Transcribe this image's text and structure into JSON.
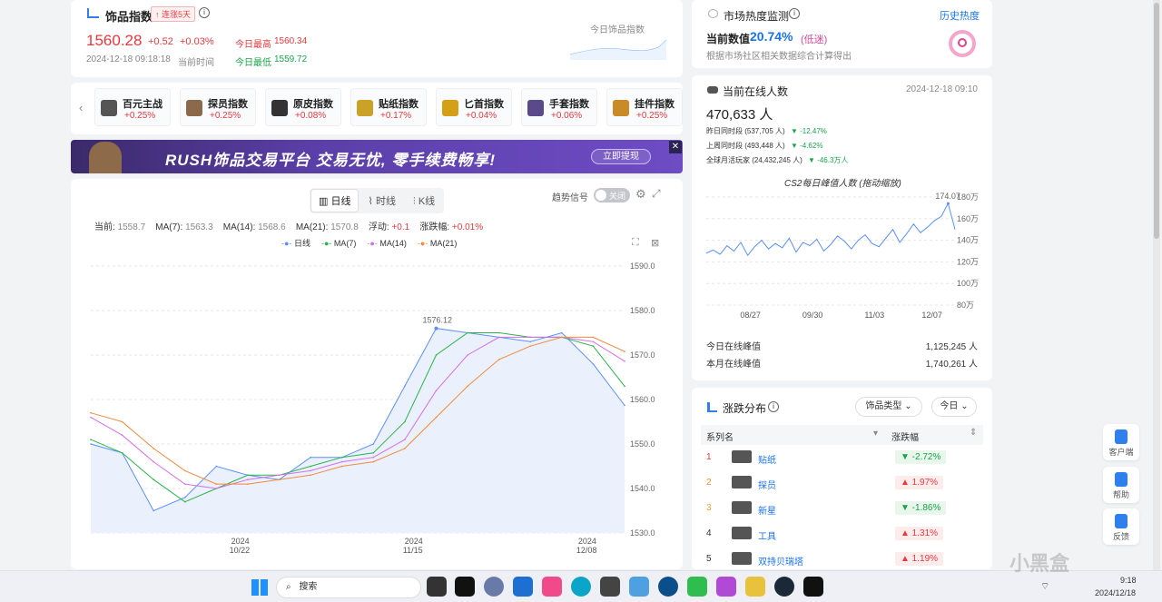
{
  "index_card": {
    "title": "饰品指数",
    "streak": "↑ 连涨5天",
    "value": "1560.28",
    "change": "+0.52",
    "change_pct": "+0.03%",
    "datetime": "2024-12-18 09:18:18",
    "datetime_label": "当前时间",
    "high_label": "今日最高",
    "high": "1560.34",
    "low_label": "今日最低",
    "low": "1559.72",
    "mini_chart_label": "今日饰品指数"
  },
  "heat": {
    "title": "市场热度监测",
    "history_link": "历史热度",
    "current_label": "当前数值",
    "current_value": "20.74%",
    "level": "(低迷)",
    "desc": "根据市场社区相关数据综合计算得出"
  },
  "categories": [
    {
      "name": "百元主战",
      "change": "+0.25%",
      "color": "#555"
    },
    {
      "name": "探员指数",
      "change": "+0.25%",
      "color": "#8a6a4a"
    },
    {
      "name": "原皮指数",
      "change": "+0.08%",
      "color": "#333"
    },
    {
      "name": "贴纸指数",
      "change": "+0.17%",
      "color": "#c9a227"
    },
    {
      "name": "匕首指数",
      "change": "+0.04%",
      "color": "#d4a017"
    },
    {
      "name": "手套指数",
      "change": "+0.06%",
      "color": "#5a4a8a"
    },
    {
      "name": "挂件指数",
      "change": "+0.25%",
      "color": "#c98a27"
    }
  ],
  "banner": {
    "text": "RUSH饰品交易平台  交易无忧, 零手续费畅享!",
    "button": "立即提现",
    "close": "✕"
  },
  "chart_tabs": [
    "日线",
    "时线",
    "K线"
  ],
  "trend_signal": {
    "label": "趋势信号",
    "state": "关闭"
  },
  "stats": {
    "current_label": "当前:",
    "current": "1558.7",
    "ma7_label": "MA(7):",
    "ma7": "1563.3",
    "ma14_label": "MA(14):",
    "ma14": "1568.6",
    "ma21_label": "MA(21):",
    "ma21": "1570.8",
    "float_label": "浮动:",
    "float": "+0.1",
    "pct_label": "涨跌幅:",
    "pct": "+0.01%"
  },
  "online": {
    "title": "当前在线人数",
    "datetime": "2024-12-18 09:10",
    "count": "470,633 人",
    "yesterday": "昨日同时段 (537,705 人)",
    "yesterday_chg": "▼ -12.47%",
    "lastweek": "上周同时段 (493,448 人)",
    "lastweek_chg": "▼ -4.62%",
    "monthly": "全球月活玩家 (24,432,245 人)",
    "monthly_chg": "▼ -46.3万人",
    "today_peak_label": "今日在线峰值",
    "today_peak": "1,125,245 人",
    "month_peak_label": "本月在线峰值",
    "month_peak": "1,740,261 人"
  },
  "ranking": {
    "title": "涨跌分布",
    "filter": "饰品类型",
    "period": "今日",
    "col_name": "系列名",
    "col_change": "涨跌幅",
    "rows": [
      {
        "rank": "1",
        "name": "贴纸",
        "change": "▼ -2.72%",
        "dir": "dn"
      },
      {
        "rank": "2",
        "name": "探员",
        "change": "▲ 1.97%",
        "dir": "up"
      },
      {
        "rank": "3",
        "name": "新星",
        "change": "▼ -1.86%",
        "dir": "dn"
      },
      {
        "rank": "4",
        "name": "工具",
        "change": "▲ 1.31%",
        "dir": "up"
      },
      {
        "rank": "5",
        "name": "双持贝瑞塔",
        "change": "▲ 1.19%",
        "dir": "up"
      }
    ]
  },
  "sidebar": {
    "client": "客户端",
    "help": "帮助",
    "feedback": "反馈"
  },
  "taskbar": {
    "search": "搜索",
    "time": "9:18",
    "date": "2024/12/18",
    "watermark": "小黑盒"
  },
  "chart_data": [
    {
      "type": "line",
      "ylim": [
        1530,
        1590
      ],
      "yticks": [
        "1590.0",
        "1580.0",
        "1570.0",
        "1560.0",
        "1550.0",
        "1540.0",
        "1530.0"
      ],
      "xticks": [
        {
          "year": "2024",
          "date": "10/22"
        },
        {
          "year": "2024",
          "date": "11/15"
        },
        {
          "year": "2024",
          "date": "12/08"
        }
      ],
      "max_label": "1576.12",
      "legend": [
        "日线",
        "MA(7)",
        "MA(14)",
        "MA(21)"
      ],
      "colors": [
        "#5b8ff9",
        "#2bb34a",
        "#d46ee8",
        "#f08a3c"
      ],
      "x": [
        "10/10",
        "10/14",
        "10/18",
        "10/22",
        "10/26",
        "10/30",
        "11/03",
        "11/07",
        "11/11",
        "11/15",
        "11/19",
        "11/23",
        "11/27",
        "12/01",
        "12/05",
        "12/09",
        "12/13",
        "12/17"
      ],
      "series": [
        {
          "name": "日线",
          "values": [
            1550,
            1548,
            1535,
            1538,
            1545,
            1543,
            1542,
            1547,
            1547,
            1550,
            1563,
            1576,
            1575,
            1574,
            1573,
            1575,
            1568,
            1558.7
          ]
        },
        {
          "name": "MA(7)",
          "values": [
            1551,
            1548,
            1542,
            1537,
            1540,
            1543,
            1543,
            1545,
            1547,
            1548,
            1555,
            1570,
            1575,
            1575,
            1574,
            1574,
            1572,
            1563
          ]
        },
        {
          "name": "MA(14)",
          "values": [
            1556,
            1552,
            1546,
            1541,
            1540,
            1542,
            1543,
            1544,
            1546,
            1547,
            1551,
            1562,
            1570,
            1574,
            1574,
            1574,
            1573,
            1568.6
          ]
        },
        {
          "name": "MA(21)",
          "values": [
            1557,
            1555,
            1549,
            1544,
            1541,
            1541,
            1542,
            1543,
            1545,
            1546,
            1549,
            1556,
            1563,
            1569,
            1572,
            1574,
            1574,
            1570.8
          ]
        }
      ]
    },
    {
      "type": "line",
      "title": "CS2每日峰值人数 (拖动缩放)",
      "yticks": [
        "180万",
        "160万",
        "140万",
        "120万",
        "100万",
        "80万"
      ],
      "ylim": [
        80,
        180
      ],
      "xticks": [
        "08/27",
        "09/30",
        "11/03",
        "12/07"
      ],
      "max_label": "174.07",
      "values": [
        128,
        131,
        127,
        135,
        130,
        138,
        126,
        134,
        140,
        132,
        137,
        133,
        142,
        129,
        138,
        135,
        141,
        130,
        136,
        144,
        139,
        132,
        140,
        145,
        137,
        134,
        142,
        150,
        138,
        146,
        155,
        147,
        152,
        158,
        162,
        174,
        150
      ]
    }
  ]
}
